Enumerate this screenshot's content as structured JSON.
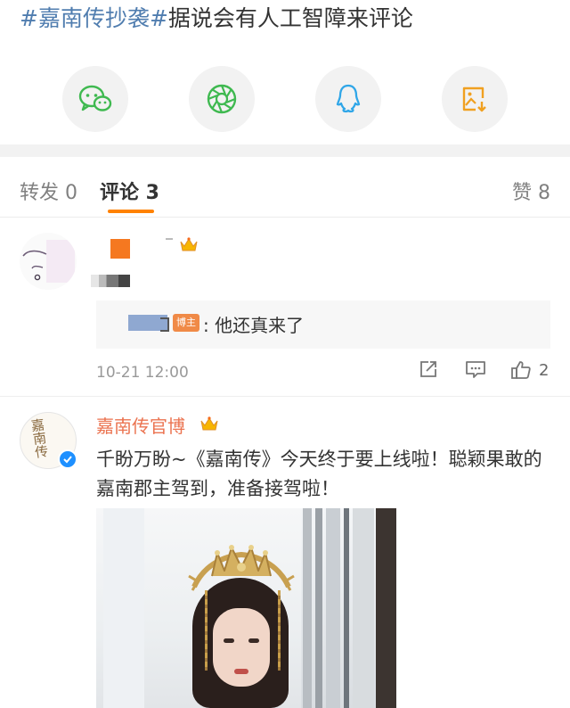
{
  "post": {
    "hashtag": "#嘉南传抄袭#",
    "headline": "据说会有人工智障来评论"
  },
  "share": [
    {
      "name": "wechat",
      "color": "#3fb950"
    },
    {
      "name": "moments",
      "color": "#3fb950"
    },
    {
      "name": "qq",
      "color": "#2fa6e8"
    },
    {
      "name": "save-image",
      "color": "#f0a020"
    }
  ],
  "tabs": {
    "repost": "转发 0",
    "comments": "评论 3",
    "likes": "赞 8"
  },
  "comment1": {
    "reply_badge": "博主",
    "reply_text": ": 他还真来了",
    "timestamp": "10-21 12:00",
    "like_count": "2"
  },
  "comment2": {
    "author": "嘉南传官博",
    "avatar_text": "嘉南传",
    "text": "千盼万盼~《嘉南传》今天终于要上线啦！聪颖果敢的嘉南郡主驾到，准备接驾啦！"
  },
  "colors": {
    "accent": "#ff8200",
    "hashtag": "#507daf",
    "official_name": "#eb7350",
    "verified": "#1e90ff"
  }
}
